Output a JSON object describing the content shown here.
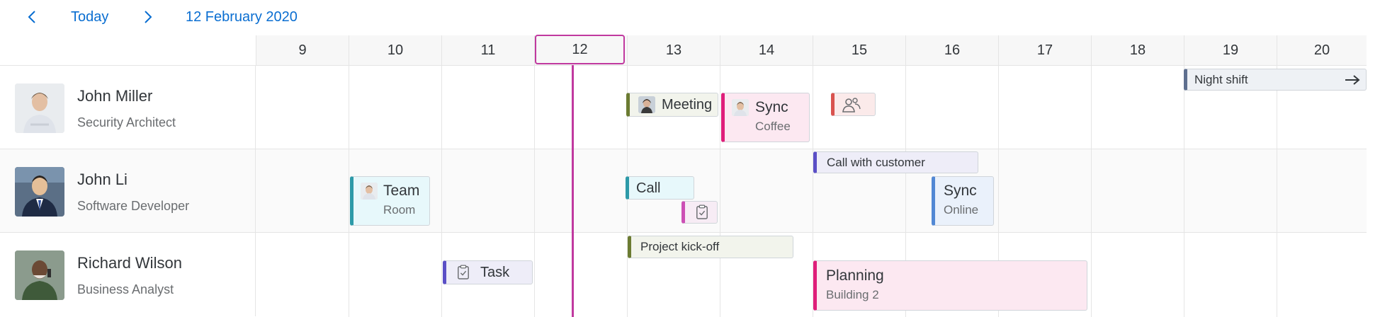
{
  "toolbar": {
    "prev_icon": "chevron-left-icon",
    "today_label": "Today",
    "next_icon": "chevron-right-icon",
    "date_label": "12 February 2020"
  },
  "colors": {
    "accent": "#0a6ed1",
    "today_marker": "#c0399f",
    "meeting": "#6b7b32",
    "sync": "#df1e7a",
    "team_call": "#2d9aa8",
    "customer_call": "#5b4fc6",
    "sync_online": "#5288d4",
    "group": "#d9534f",
    "task": "#cc4fb5",
    "night_shift": "#5e6f8f"
  },
  "days": [
    "9",
    "10",
    "11",
    "12",
    "13",
    "14",
    "15",
    "16",
    "17",
    "18",
    "19",
    "20"
  ],
  "people": [
    {
      "name": "John Miller",
      "role": "Security Architect"
    },
    {
      "name": "John Li",
      "role": "Software Developer"
    },
    {
      "name": "Richard Wilson",
      "role": "Business Analyst"
    }
  ],
  "appointments": {
    "meeting": {
      "title": "Meeting"
    },
    "sync_coffee": {
      "title": "Sync",
      "subtitle": "Coffee"
    },
    "group_icon": "group-icon",
    "night_shift": {
      "title": "Night shift",
      "icon": "arrow-right-icon"
    },
    "team_room": {
      "title": "Team",
      "subtitle": "Room"
    },
    "call": {
      "title": "Call"
    },
    "task_icon": "clipboard-task-icon",
    "call_customer": {
      "title": "Call with customer"
    },
    "sync_online": {
      "title": "Sync",
      "subtitle": "Online"
    },
    "project_kickoff": {
      "title": "Project kick-off"
    },
    "task": {
      "title": "Task"
    },
    "planning": {
      "title": "Planning",
      "subtitle": "Building 2"
    }
  }
}
